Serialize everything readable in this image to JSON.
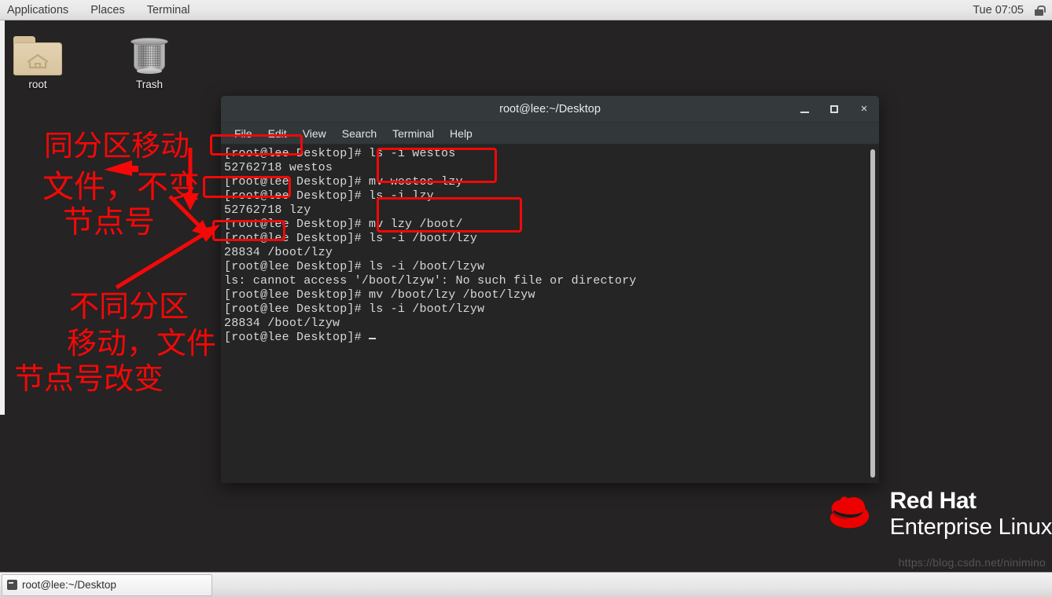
{
  "top_panel": {
    "menus": [
      "Applications",
      "Places",
      "Terminal"
    ],
    "clock": "Tue 07:05",
    "tray_icon": "lock-icon"
  },
  "desktop": {
    "background_color": "#252323",
    "icons": [
      {
        "name": "home-folder-icon",
        "label": "root"
      },
      {
        "name": "trash-icon",
        "label": "Trash"
      }
    ]
  },
  "terminal": {
    "title": "root@lee:~/Desktop",
    "menus": [
      "File",
      "Edit",
      "View",
      "Search",
      "Terminal",
      "Help"
    ],
    "window_buttons": {
      "minimize": "minimize-icon",
      "maximize": "maximize-icon",
      "close": "×"
    },
    "lines": [
      "[root@lee Desktop]# ls -i westos",
      "52762718 westos",
      "[root@lee Desktop]# mv westos lzy",
      "[root@lee Desktop]# ls -i lzy",
      "52762718 lzy",
      "[root@lee Desktop]# mv lzy /boot/",
      "[root@lee Desktop]# ls -i /boot/lzy",
      "28834 /boot/lzy",
      "[root@lee Desktop]# ls -i /boot/lzyw",
      "ls: cannot access '/boot/lzyw': No such file or directory",
      "[root@lee Desktop]# mv /boot/lzy /boot/lzyw",
      "[root@lee Desktop]# ls -i /boot/lzyw",
      "28834 /boot/lzyw",
      "[root@lee Desktop]# "
    ]
  },
  "annotations": {
    "color": "#f40808",
    "note_same_partition": {
      "line1": "同分区移动",
      "line2": "文件，不变",
      "line3": "节点号"
    },
    "note_diff_partition": {
      "line1": "不同分区",
      "line2": "移动，文件",
      "line3": "节点号改变"
    },
    "highlight_boxes": [
      {
        "name": "inode-westos-box",
        "target": "52762718 westos"
      },
      {
        "name": "mv-westos-lzy-box",
        "target": "mv westos lzy / ls -i lzy"
      },
      {
        "name": "inode-lzy-box",
        "target": "52762718 lzy"
      },
      {
        "name": "mv-lzy-boot-box",
        "target": "mv lzy /boot/ / ls -i /boot/lzy"
      },
      {
        "name": "inode-boot-lzy-box",
        "target": "28834 /boot/lzy"
      }
    ]
  },
  "branding": {
    "line1": "Red Hat",
    "line2": "Enterprise Linux",
    "logo": "redhat-fedora-icon",
    "logo_color": "#ee0000"
  },
  "watermark": "https://blog.csdn.net/ninimino",
  "taskbar": {
    "window_button_label": "root@lee:~/Desktop",
    "window_button_icon": "terminal-icon"
  }
}
